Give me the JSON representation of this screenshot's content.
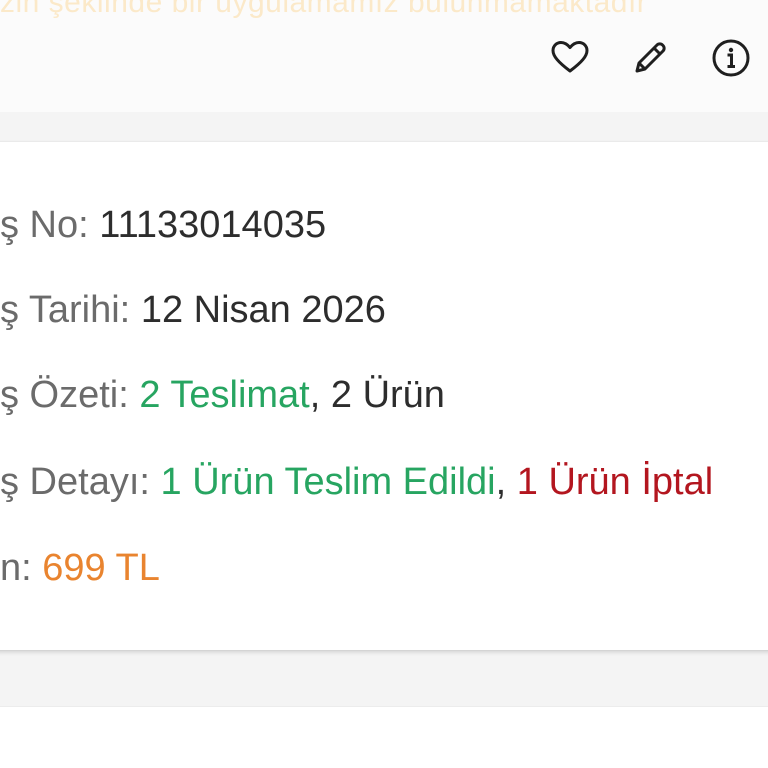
{
  "header": {
    "banner_text": "zin şeklinde bir uygulamamız bulunmamaktadır",
    "icons": [
      "heart-icon",
      "pencil-icon",
      "info-icon"
    ]
  },
  "order": {
    "no_label": "ş No:",
    "no_value": "11133014035",
    "date_label": "ş Tarihi:",
    "date_value": "12 Nisan 2026",
    "summary_label": "ş Özeti:",
    "summary_deliveries": "2 Teslimat",
    "summary_sep": ",",
    "summary_items": "2 Ürün",
    "detail_label": "ş Detayı:",
    "detail_delivered": "1 Ürün Teslim Edildi",
    "detail_sep": ",",
    "detail_cancelled": "1 Ürün İptal",
    "total_label": "n:",
    "total_value": "699 TL"
  },
  "colors": {
    "green": "#27a561",
    "red": "#b3161f",
    "orange": "#e9842f",
    "banner": "#fbe9c9"
  }
}
